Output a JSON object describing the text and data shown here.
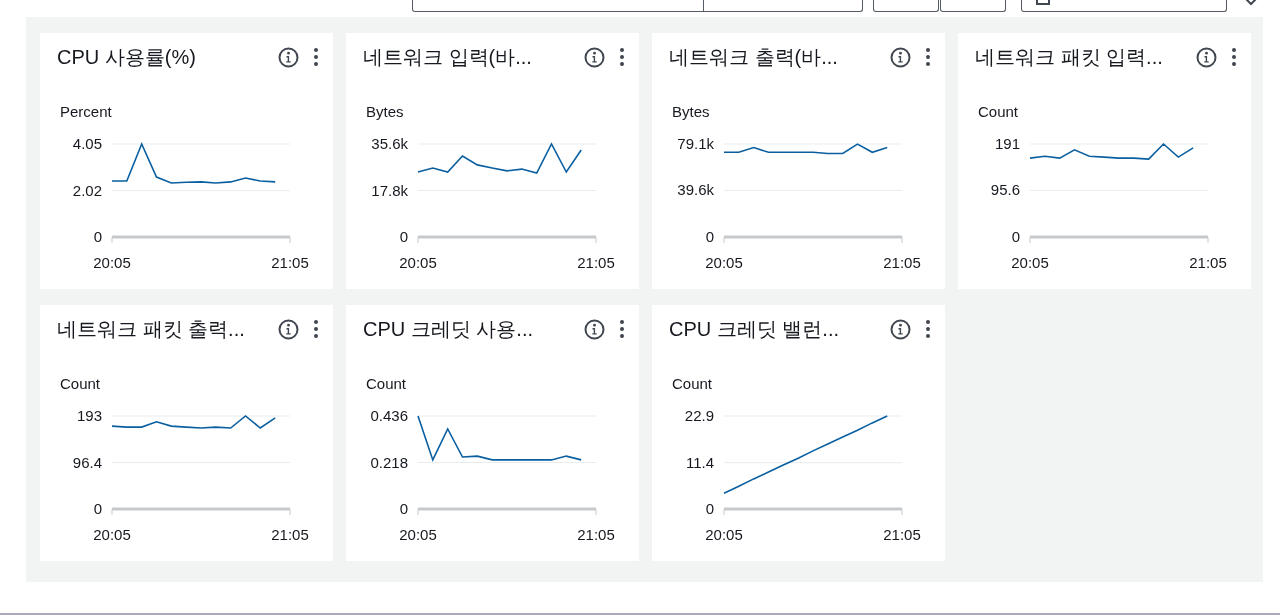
{
  "widgets": [
    {
      "title": "CPU 사용률(%)",
      "chart_data": {
        "type": "line",
        "ylabel": "Percent",
        "categories": [
          "20:05",
          null,
          null,
          null,
          null,
          null,
          null,
          null,
          null,
          null,
          null,
          null,
          "21:05"
        ],
        "ylim": [
          0,
          4.05
        ],
        "yticks": [
          0,
          2.02,
          4.05
        ],
        "series": [
          {
            "color": "#0a5fa0",
            "values": [
              2.44,
              2.44,
              4.05,
              2.61,
              2.35,
              2.38,
              2.4,
              2.35,
              2.4,
              2.57,
              2.44,
              2.4,
              null
            ]
          }
        ]
      }
    },
    {
      "title": "네트워크 입력(바...",
      "chart_data": {
        "type": "line",
        "ylabel": "Bytes",
        "categories": [
          "20:05",
          null,
          null,
          null,
          null,
          null,
          null,
          null,
          null,
          null,
          null,
          null,
          "21:05"
        ],
        "ylim": [
          0,
          35.6
        ],
        "yticks": [
          {
            "value": 0,
            "label": "0"
          },
          {
            "value": 17.8,
            "label": "17.8k"
          },
          {
            "value": 35.6,
            "label": "35.6k"
          }
        ],
        "series": [
          {
            "color": "#0a5fa0",
            "values": [
              24.9,
              26.4,
              24.9,
              31.0,
              27.6,
              26.4,
              25.3,
              26.0,
              24.5,
              35.6,
              24.9,
              33.3,
              null
            ]
          }
        ]
      }
    },
    {
      "title": "네트워크 출력(바...",
      "chart_data": {
        "type": "line",
        "ylabel": "Bytes",
        "categories": [
          "20:05",
          null,
          null,
          null,
          null,
          null,
          null,
          null,
          null,
          null,
          null,
          null,
          "21:05"
        ],
        "ylim": [
          0,
          79.1
        ],
        "yticks": [
          {
            "value": 0,
            "label": "0"
          },
          {
            "value": 39.6,
            "label": "39.6k"
          },
          {
            "value": 79.1,
            "label": "79.1k"
          }
        ],
        "series": [
          {
            "color": "#0a5fa0",
            "values": [
              72,
              72,
              76,
              72,
              72,
              72,
              72,
              71,
              71,
              79,
              72,
              76,
              null
            ]
          }
        ]
      }
    },
    {
      "title": "네트워크 패킷 입력...",
      "chart_data": {
        "type": "line",
        "ylabel": "Count",
        "categories": [
          "20:05",
          null,
          null,
          null,
          null,
          null,
          null,
          null,
          null,
          null,
          null,
          null,
          "21:05"
        ],
        "ylim": [
          0,
          191
        ],
        "yticks": [
          0,
          95.6,
          191
        ],
        "series": [
          {
            "color": "#0a5fa0",
            "values": [
              162,
              166,
              162,
              179,
              166,
              164,
              162,
              162,
              160,
              191,
              164,
              183,
              null
            ]
          }
        ]
      }
    },
    {
      "title": "네트워크 패킷 출력...",
      "chart_data": {
        "type": "line",
        "ylabel": "Count",
        "categories": [
          "20:05",
          null,
          null,
          null,
          null,
          null,
          null,
          null,
          null,
          null,
          null,
          null,
          "21:05"
        ],
        "ylim": [
          0,
          193
        ],
        "yticks": [
          0,
          96.4,
          193
        ],
        "series": [
          {
            "color": "#0a5fa0",
            "values": [
              172,
              170,
              170,
              181,
              172,
              170,
              168,
              170,
              168,
              193,
              168,
              189,
              null
            ]
          }
        ]
      }
    },
    {
      "title": "CPU 크레딧 사용...",
      "chart_data": {
        "type": "line",
        "ylabel": "Count",
        "categories": [
          "20:05",
          null,
          null,
          null,
          null,
          null,
          null,
          null,
          null,
          null,
          null,
          null,
          "21:05"
        ],
        "ylim": [
          0,
          0.436
        ],
        "yticks": [
          0,
          0.218,
          0.436
        ],
        "series": [
          {
            "color": "#0a5fa0",
            "values": [
              0.436,
              0.23,
              0.375,
              0.244,
              0.248,
              0.23,
              0.23,
              0.23,
              0.23,
              0.23,
              0.248,
              0.23,
              null
            ]
          }
        ]
      }
    },
    {
      "title": "CPU 크레딧 밸런...",
      "chart_data": {
        "type": "line",
        "ylabel": "Count",
        "categories": [
          "20:05",
          null,
          null,
          null,
          null,
          null,
          null,
          null,
          null,
          null,
          null,
          null,
          "21:05"
        ],
        "ylim": [
          0,
          22.9
        ],
        "yticks": [
          0,
          11.4,
          22.9
        ],
        "series": [
          {
            "color": "#0a5fa0",
            "values": [
              3.9,
              5.6,
              7.4,
              9.1,
              10.8,
              12.5,
              14.3,
              16.0,
              17.7,
              19.4,
              21.2,
              22.9,
              null
            ]
          }
        ]
      }
    }
  ]
}
